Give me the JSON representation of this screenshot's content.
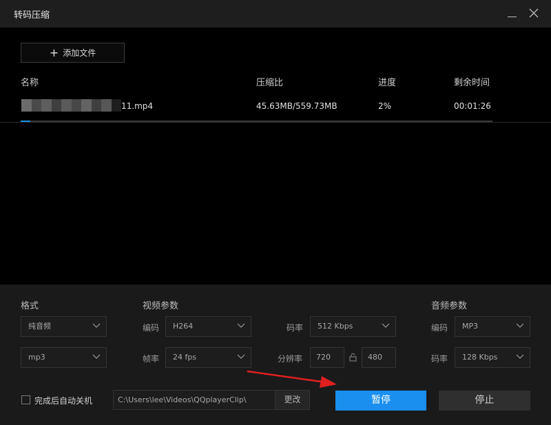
{
  "window": {
    "title": "转码压缩"
  },
  "toolbar": {
    "add_label": "添加文件"
  },
  "columns": {
    "name": "名称",
    "ratio": "压缩比",
    "progress": "进度",
    "remaining": "剩余时间"
  },
  "file": {
    "name_suffix": "11.mp4",
    "ratio": "45.63MB/559.73MB",
    "progress": "2%",
    "progress_value": 2,
    "remaining": "00:01:26"
  },
  "format": {
    "title": "格式",
    "type": "纯音频",
    "container": "mp3"
  },
  "video": {
    "title": "视频参数",
    "codec_label": "编码",
    "codec": "H264",
    "fps_label": "帧率",
    "fps": "24 fps",
    "bitrate_label": "码率",
    "bitrate": "512 Kbps",
    "resolution_label": "分辨率",
    "width": "720",
    "height": "480"
  },
  "audio": {
    "title": "音频参数",
    "codec_label": "编码",
    "codec": "MP3",
    "bitrate_label": "码率",
    "bitrate": "128 Kbps"
  },
  "footer": {
    "shutdown_label": "完成后自动关机",
    "output_path": "C:\\Users\\lee\\Videos\\QQplayerClip\\",
    "change_label": "更改",
    "pause_label": "暂停",
    "stop_label": "停止"
  },
  "colors": {
    "accent": "#1a8ff0",
    "annotation": "#e02020"
  }
}
